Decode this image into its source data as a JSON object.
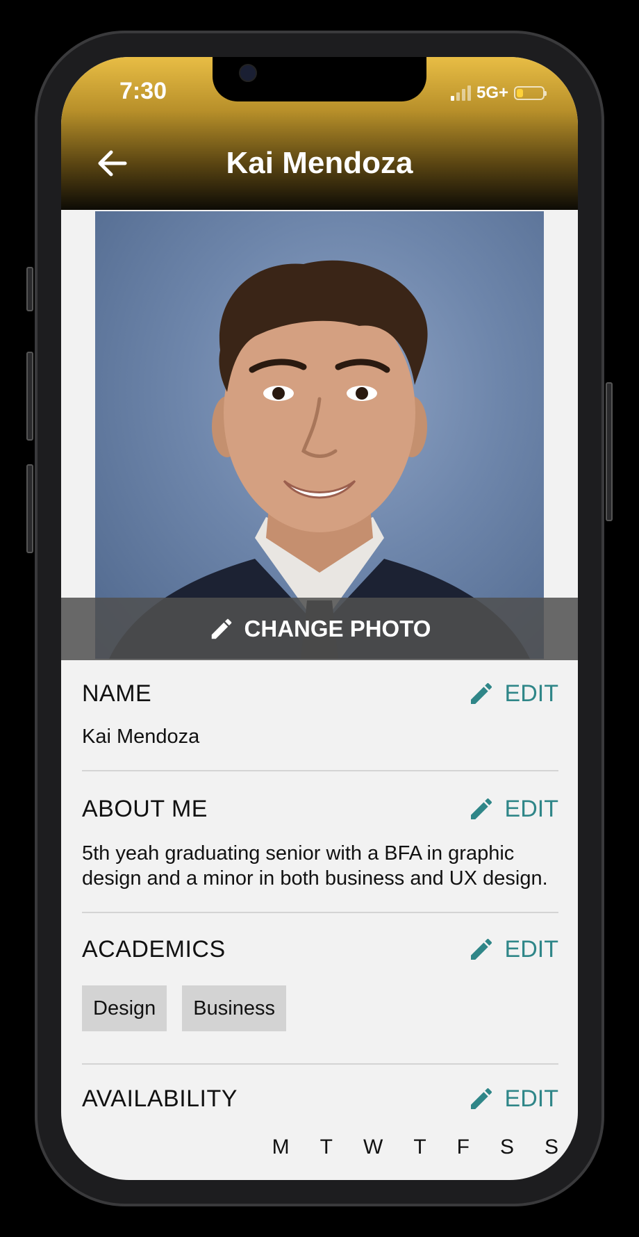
{
  "status_bar": {
    "time": "7:30",
    "network": "5G+",
    "battery_level": 0.25
  },
  "header": {
    "title": "Kai Mendoza"
  },
  "photo": {
    "change_label": "CHANGE PHOTO"
  },
  "colors": {
    "accent": "#2f8688",
    "header_top": "#e8bd45",
    "chip_bg": "#d3d3d3"
  },
  "sections": {
    "name": {
      "title": "NAME",
      "edit_label": "EDIT",
      "value": "Kai Mendoza"
    },
    "about": {
      "title": "ABOUT ME",
      "edit_label": "EDIT",
      "value": "5th yeah graduating senior with a BFA in graphic design and a minor in both business and UX design."
    },
    "academics": {
      "title": "ACADEMICS",
      "edit_label": "EDIT",
      "chips": [
        "Design",
        "Business"
      ]
    },
    "availability": {
      "title": "AVAILABILITY",
      "edit_label": "EDIT",
      "days": [
        "M",
        "T",
        "W",
        "T",
        "F",
        "S",
        "S"
      ]
    }
  }
}
